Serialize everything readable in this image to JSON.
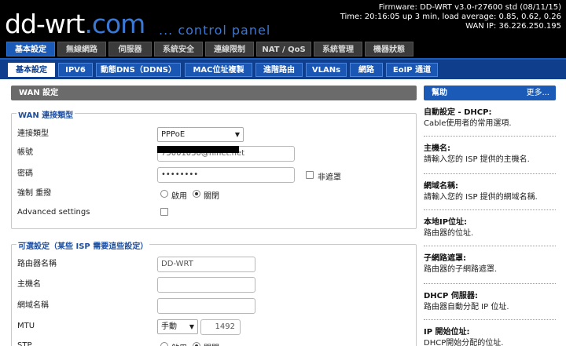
{
  "header": {
    "logo_main": "dd-wrt",
    "logo_dot": ".",
    "logo_com": "com",
    "logo_sub": "... control panel",
    "firmware": "Firmware: DD-WRT v3.0-r27600 std (08/11/15)",
    "time": "Time: 20:16:05 up 3 min, load average: 0.85, 0.62, 0.26",
    "wan_ip": "WAN IP: 36.226.250.195"
  },
  "main_tabs": [
    {
      "label": "基本設定",
      "active": true
    },
    {
      "label": "無線網路",
      "active": false
    },
    {
      "label": "伺服器",
      "active": false
    },
    {
      "label": "系統安全",
      "active": false
    },
    {
      "label": "連線限制",
      "active": false
    },
    {
      "label": "NAT / QoS",
      "active": false
    },
    {
      "label": "系統管理",
      "active": false
    },
    {
      "label": "機器狀態",
      "active": false
    }
  ],
  "sub_tabs": [
    {
      "label": "基本設定",
      "active": true
    },
    {
      "label": "IPV6",
      "active": false
    },
    {
      "label": "動態DNS（DDNS）",
      "active": false
    },
    {
      "label": "MAC位址複製",
      "active": false
    },
    {
      "label": "進階路由",
      "active": false
    },
    {
      "label": "VLANs",
      "active": false
    },
    {
      "label": "網路",
      "active": false
    },
    {
      "label": "EoIP 通道",
      "active": false
    }
  ],
  "wan": {
    "section_title": "WAN 設定",
    "legend": "WAN 連接類型",
    "connection_type_label": "連接類型",
    "connection_type_value": "PPPoE",
    "username_label": "帳號",
    "username_value": "75001030@hinet.net",
    "password_label": "密碼",
    "password_value": "••••••••",
    "unmask_label": "非遮罩",
    "force_reconnect_label": "強制 重撥",
    "enable_label": "啟用",
    "disable_label": "關閉",
    "advanced_label": "Advanced settings"
  },
  "optional": {
    "legend": "可選設定（某些 ISP 需要這些設定）",
    "router_name_label": "路由器名稱",
    "router_name_value": "DD-WRT",
    "hostname_label": "主機名",
    "domain_label": "網域名稱",
    "mtu_label": "MTU",
    "mtu_mode": "手動",
    "mtu_value": "1492",
    "stp_label": "STP",
    "stp_enable": "啟用",
    "stp_disable": "關閉"
  },
  "help": {
    "title": "幫助",
    "more": "更多...",
    "items": [
      {
        "title": "自動設定 - DHCP:",
        "text": "Cable使用者的常用選項."
      },
      {
        "title": "主機名:",
        "text": "請輸入您的 ISP 提供的主機名."
      },
      {
        "title": "網域名稱:",
        "text": "請輸入您的 ISP 提供的網域名稱."
      },
      {
        "title": "本地IP位址:",
        "text": "路由器的位址."
      },
      {
        "title": "子網路遮罩:",
        "text": "路由器的子網路遮罩."
      },
      {
        "title": "DHCP 伺服器:",
        "text": "路由器自動分配 IP 位址."
      },
      {
        "title": "IP 開始位址:",
        "text": "DHCP開始分配的位址."
      }
    ]
  }
}
